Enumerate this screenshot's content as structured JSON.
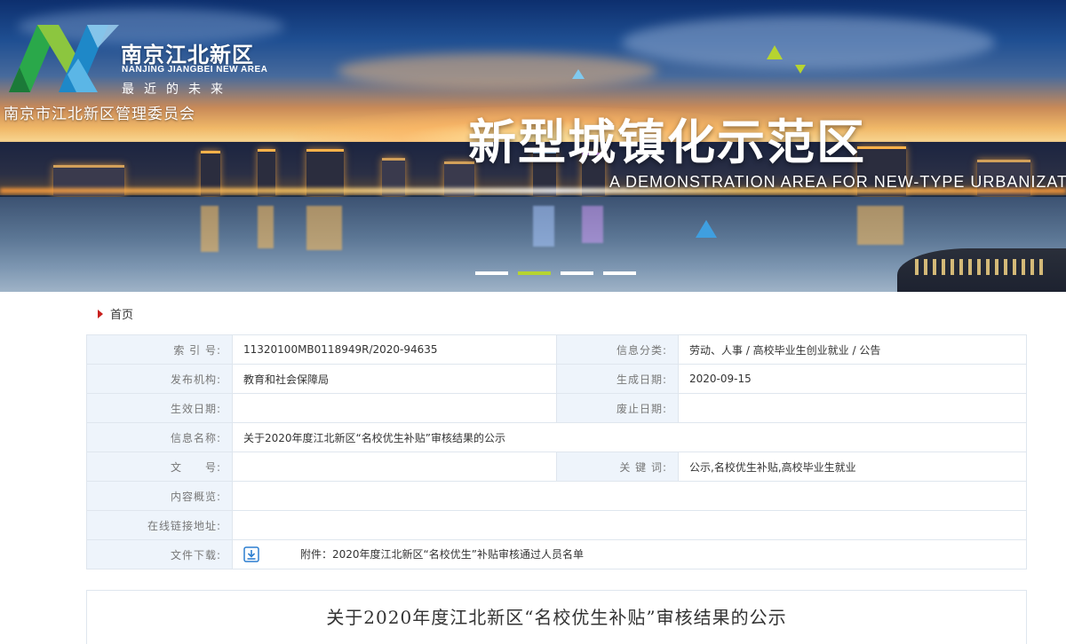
{
  "banner": {
    "logo_cn": "南京江北新区",
    "logo_en": "NANJING JIANGBEI NEW AREA",
    "logo_slogan": "最近的未来",
    "committee": "南京市江北新区管理委员会",
    "headline": "新型城镇化示范区",
    "headline_en": "A DEMONSTRATION AREA FOR NEW-TYPE URBANIZAT",
    "slides": 4,
    "active_slide": 2,
    "logo_colors": [
      "#2aa84a",
      "#8cc63f",
      "#1e88c8",
      "#5bb6e6"
    ]
  },
  "breadcrumb": {
    "home_label": "首页"
  },
  "info": {
    "index_label": "索 引 号:",
    "index_value": "11320100MB0118949R/2020-94635",
    "category_label": "信息分类:",
    "category_value": "劳动、人事 / 高校毕业生创业就业 / 公告",
    "publisher_label": "发布机构:",
    "publisher_value": "教育和社会保障局",
    "created_label": "生成日期:",
    "created_value": "2020-09-15",
    "effective_label": "生效日期:",
    "effective_value": "",
    "expire_label": "废止日期:",
    "expire_value": "",
    "name_label": "信息名称:",
    "name_value": "关于2020年度江北新区“名校优生补贴”审核结果的公示",
    "docno_label": "文　　号:",
    "docno_value": "",
    "keywords_label": "关 键 词:",
    "keywords_value": "公示,名校优生补贴,高校毕业生就业",
    "summary_label": "内容概览:",
    "summary_value": "",
    "link_label": "在线链接地址:",
    "link_value": "",
    "download_label": "文件下载:",
    "attachment_text": "附件：2020年度江北新区“名校优生”补贴审核通过人员名单"
  },
  "article": {
    "title": "关于2020年度江北新区“名校优生补贴”审核结果的公示"
  }
}
